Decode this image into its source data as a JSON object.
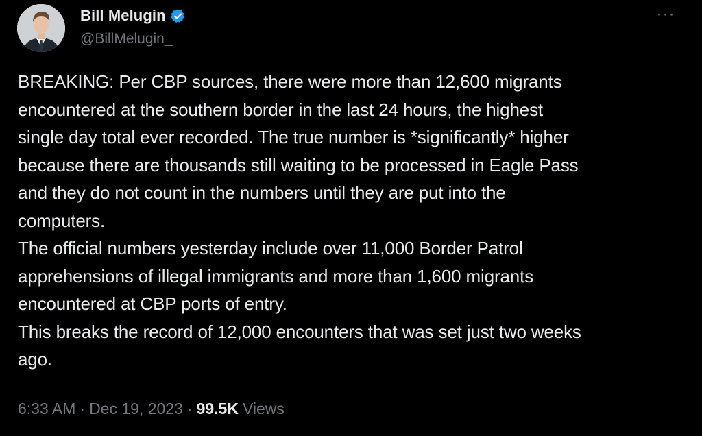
{
  "author": {
    "display_name": "Bill Melugin",
    "handle": "@BillMelugin_",
    "verified": true,
    "avatar_icon": "avatar-photo"
  },
  "more_menu": {
    "icon": "more-horizontal-icon",
    "label": "···"
  },
  "tweet": {
    "text": "BREAKING: Per CBP sources, there were more than 12,600 migrants\nencountered at the southern border in the last 24 hours, the highest\nsingle day total ever recorded. The true number is *significantly* higher\nbecause there are thousands still waiting to be processed in Eagle Pass\nand they do not count in the numbers until they are put into the\ncomputers.\nThe official numbers yesterday include over 11,000 Border Patrol\napprehensions of illegal immigrants and more than 1,600 migrants\nencountered at CBP ports of entry.\nThis breaks the record of 12,000 encounters that was set just two weeks\nago."
  },
  "meta": {
    "time": "6:33 AM",
    "separator": "·",
    "date": "Dec 19, 2023",
    "views_count": "99.5K",
    "views_label": "Views"
  },
  "colors": {
    "background": "#000000",
    "primary_text": "#e7e9ea",
    "secondary_text": "#71767b",
    "verified_badge": "#1d9bf0"
  }
}
